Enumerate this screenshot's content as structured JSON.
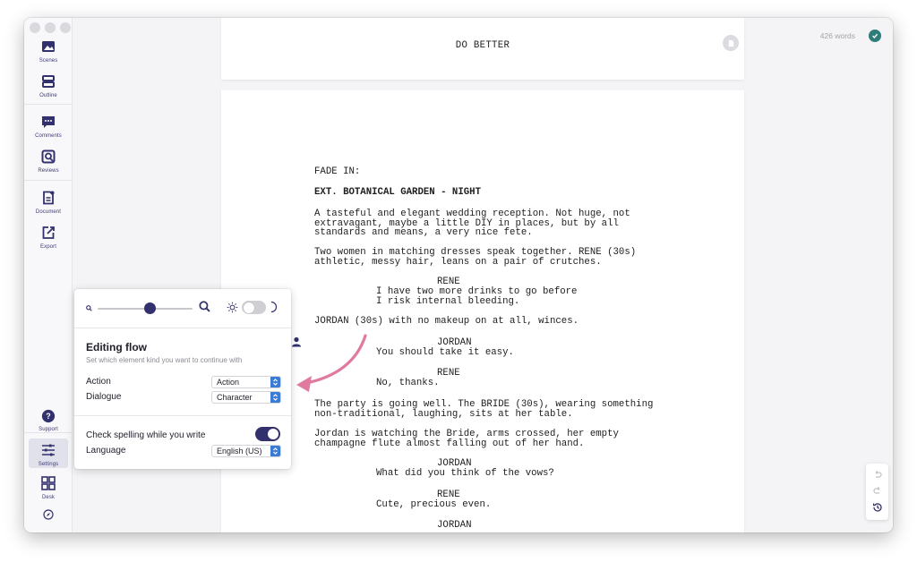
{
  "sidebar": {
    "items": [
      {
        "label": "Scenes",
        "icon": "scenes-icon"
      },
      {
        "label": "Outline",
        "icon": "outline-icon"
      },
      {
        "label": "Comments",
        "icon": "comments-icon"
      },
      {
        "label": "Reviews",
        "icon": "reviews-icon"
      },
      {
        "label": "Document",
        "icon": "document-icon"
      },
      {
        "label": "Export",
        "icon": "export-icon"
      },
      {
        "label": "Support",
        "icon": "help-icon"
      },
      {
        "label": "Settings",
        "icon": "sliders-icon"
      },
      {
        "label": "Desk",
        "icon": "grid-icon"
      }
    ]
  },
  "header": {
    "word_count": "426 words",
    "title_page_title": "DO BETTER"
  },
  "script": {
    "lines": [
      {
        "text": "FADE IN:",
        "kind": "transition"
      },
      {
        "text": "EXT. BOTANICAL GARDEN - NIGHT",
        "kind": "scene-heading"
      },
      {
        "text": "A tasteful and elegant wedding reception. Not huge, not",
        "kind": "action"
      },
      {
        "text": "extravagant, maybe a little DIY in places, but by all",
        "kind": "action"
      },
      {
        "text": "standards and means, a very nice fete.",
        "kind": "action"
      },
      {
        "text": "Two women in matching dresses speak together. RENE (30s)",
        "kind": "action"
      },
      {
        "text": "athletic, messy hair, leans on a pair of crutches.",
        "kind": "action"
      },
      {
        "text": "RENE",
        "kind": "character"
      },
      {
        "text": "I have two more drinks to go before",
        "kind": "dialogue"
      },
      {
        "text": "I risk internal bleeding.",
        "kind": "dialogue"
      },
      {
        "text": "JORDAN (30s) with no makeup on at all, winces.",
        "kind": "action"
      },
      {
        "text": "JORDAN",
        "kind": "character"
      },
      {
        "text": "You should take it easy.",
        "kind": "dialogue"
      },
      {
        "text": "RENE",
        "kind": "character"
      },
      {
        "text": "No, thanks.",
        "kind": "dialogue"
      },
      {
        "text": "The party is going well. The BRIDE (30s), wearing something",
        "kind": "action"
      },
      {
        "text": "non-traditional, laughing, sits at her table.",
        "kind": "action"
      },
      {
        "text": "Jordan is watching the Bride, arms crossed, her empty",
        "kind": "action"
      },
      {
        "text": "champagne flute almost falling out of her hand.",
        "kind": "action"
      },
      {
        "text": "JORDAN",
        "kind": "character"
      },
      {
        "text": "What did you think of the vows?",
        "kind": "dialogue"
      },
      {
        "text": "RENE",
        "kind": "character"
      },
      {
        "text": "Cute, precious even.",
        "kind": "dialogue"
      },
      {
        "text": "JORDAN",
        "kind": "character"
      }
    ]
  },
  "settings_popover": {
    "zoom_level": 0.55,
    "dark_mode": false,
    "editing_flow_title": "Editing flow",
    "editing_flow_subtitle": "Set which element kind you want to continue with",
    "rows": [
      {
        "label": "Action",
        "value": "Action"
      },
      {
        "label": "Dialogue",
        "value": "Character"
      }
    ],
    "spellcheck_label": "Check spelling while you write",
    "spellcheck_on": true,
    "language_label": "Language",
    "language_value": "English (US)"
  },
  "colors": {
    "accent": "#32306d",
    "select_arrow": "#3a7bd5",
    "annotation_arrow": "#e07aa0",
    "saved_badge": "#2f7d7a"
  }
}
